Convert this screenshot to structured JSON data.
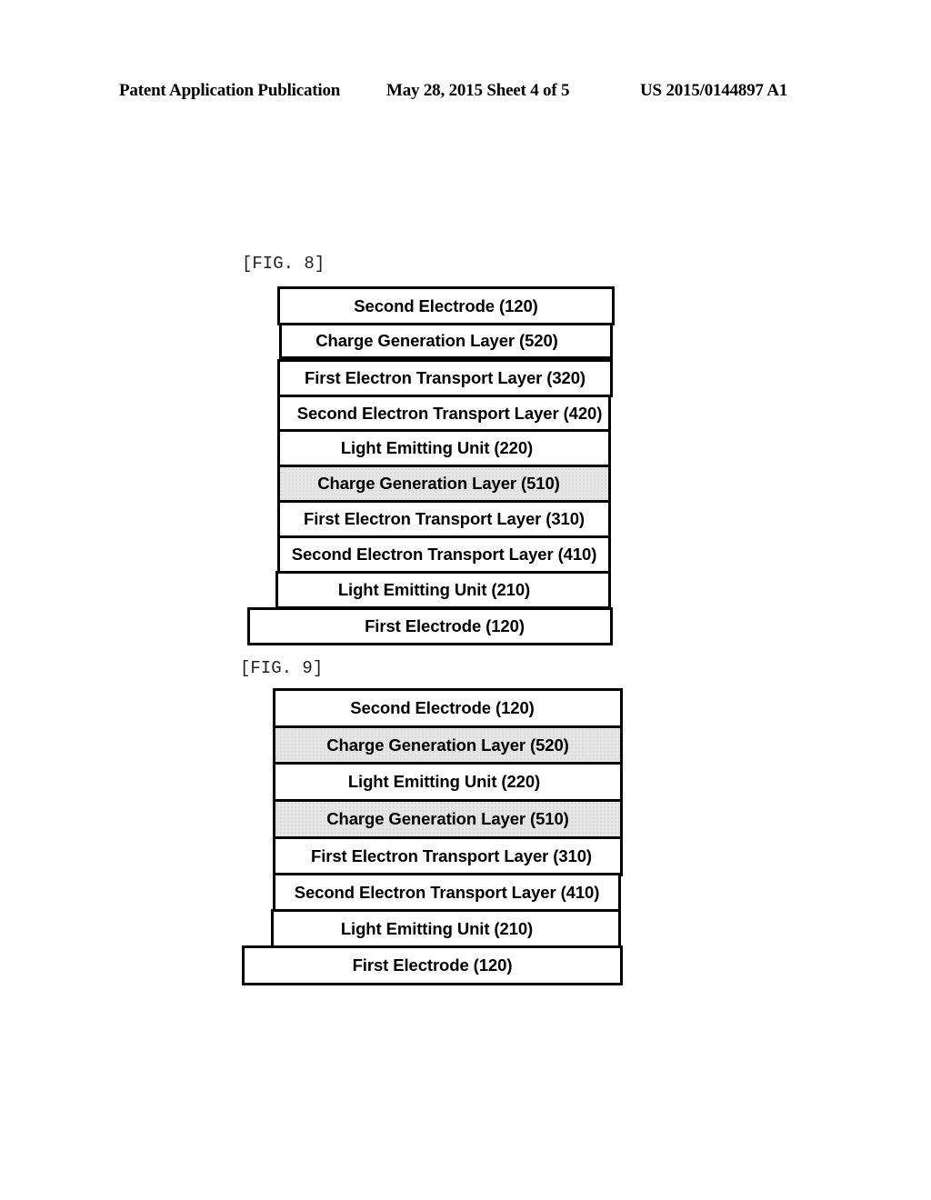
{
  "header": {
    "publication": "Patent Application Publication",
    "date_sheet": "May 28, 2015  Sheet 4 of 5",
    "number": "US 2015/0144897 A1"
  },
  "fig8": {
    "label": "[FIG. 8]",
    "layers": [
      {
        "text": "Second Electrode (120)",
        "shaded": false
      },
      {
        "text": "Charge Generation Layer (520)",
        "shaded": false
      },
      {
        "text": "First Electron Transport Layer (320)",
        "shaded": false
      },
      {
        "text": "Second Electron Transport Layer (420)",
        "shaded": false
      },
      {
        "text": "Light Emitting Unit (220)",
        "shaded": false
      },
      {
        "text": "Charge Generation Layer (510)",
        "shaded": true
      },
      {
        "text": "First Electron Transport Layer (310)",
        "shaded": false
      },
      {
        "text": "Second Electron Transport Layer (410)",
        "shaded": false
      },
      {
        "text": "Light Emitting Unit (210)",
        "shaded": false
      },
      {
        "text": "First Electrode  (120)",
        "shaded": false
      }
    ]
  },
  "fig9": {
    "label": "[FIG. 9]",
    "layers": [
      {
        "text": "Second Electrode (120)",
        "shaded": false
      },
      {
        "text": "Charge Generation Layer (520)",
        "shaded": true
      },
      {
        "text": "Light Emitting Unit (220)",
        "shaded": false
      },
      {
        "text": "Charge Generation Layer (510)",
        "shaded": true
      },
      {
        "text": "First Electron Transport Layer (310)",
        "shaded": false
      },
      {
        "text": "Second Electron Transport Layer (410)",
        "shaded": false
      },
      {
        "text": "Light Emitting Unit (210)",
        "shaded": false
      },
      {
        "text": "First Electrode (120)",
        "shaded": false
      }
    ]
  }
}
